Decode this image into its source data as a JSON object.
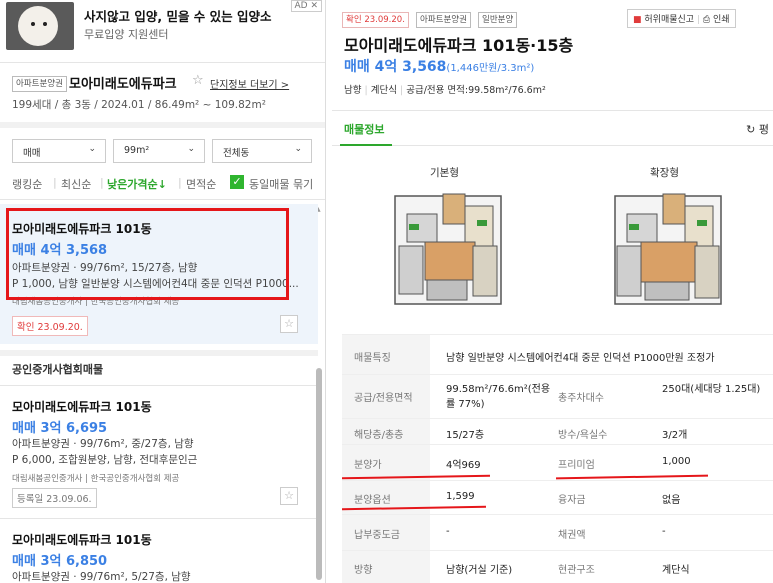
{
  "ad": {
    "badge": "AD ✕",
    "title": "사지않고 입양, 믿을 수 있는 입양소",
    "subtitle": "무료입양 지원센터"
  },
  "complex": {
    "tag": "아파트분양권",
    "name": "모아미래도에듀파크",
    "more_link": "단지정보 더보기 >",
    "meta": "199세대 / 총 3동 / 2024.01 / 86.49m² ~ 109.82m²"
  },
  "filters": {
    "type": "매매",
    "area": "99m²",
    "dong": "전체동"
  },
  "sort": {
    "items": [
      "랭킹순",
      "최신순",
      "낮은가격순↓",
      "면적순"
    ],
    "same_listing_label": "동일매물 묶기"
  },
  "listings": [
    {
      "title": "모아미래도에듀파크 101동",
      "price": "매매 4억 3,568",
      "spec": "아파트분양권 · 99/76m², 15/27층, 남향",
      "desc": "P 1,000, 남향 일반분양 시스템에어컨4대 중문 인덕션 P1000...",
      "agent": "대림새봄공인중개사 | 한국공인중개사협회 제공",
      "confirm": "확인 23.09.20."
    },
    {
      "title": "모아미래도에듀파크 101동",
      "price": "매매 3억 6,695",
      "spec": "아파트분양권 · 99/76m², 중/27층, 남향",
      "desc": "P 6,000, 조합원분양, 남향, 전대후문인근",
      "agent": "대림새봄공인중개사 | 한국공인중개사협회 제공",
      "confirm": "등록일 23.09.06."
    },
    {
      "title": "모아미래도에듀파크 101동",
      "price": "매매 3억 6,850",
      "spec": "아파트분양권 · 99/76m², 5/27층, 남향"
    }
  ],
  "section_title": "공인중개사협회매물",
  "detail": {
    "tags": [
      "확인 23.09.20.",
      "아파트분양권",
      "일반분양"
    ],
    "report": "허위매물신고",
    "print": "인쇄",
    "title": "모아미래도에듀파크 101동·15층",
    "price": "매매 4억 3,568",
    "price_per": "(1,446만원/3.3m²)",
    "meta": [
      "남향",
      "계단식",
      "공급/전용 면적:99.58m²/76.6m²"
    ],
    "tab": "매물정보",
    "refresh": "평",
    "plan_basic": "기본형",
    "plan_ext": "확장형",
    "rows": [
      {
        "k1": "매물특징",
        "v1": "남향 일반분양 시스템에어컨4대 중문 인덕션 P1000만원 조정가"
      },
      {
        "k1": "공급/전용면적",
        "v1": "99.58m²/76.6m²(전용률 77%)",
        "k2": "총주차대수",
        "v2": "250대(세대당 1.25대)"
      },
      {
        "k1": "해당층/총층",
        "v1": "15/27층",
        "k2": "방수/욕실수",
        "v2": "3/2개"
      },
      {
        "k1": "분양가",
        "v1": "4억969",
        "k2": "프리미엄",
        "v2": "1,000"
      },
      {
        "k1": "분양옵션",
        "v1": "1,599",
        "k2": "융자금",
        "v2": "없음"
      },
      {
        "k1": "납부중도금",
        "v1": "-",
        "k2": "채권액",
        "v2": "-"
      },
      {
        "k1": "방향",
        "v1": "남향(거실 기준)",
        "k2": "현관구조",
        "v2": "계단식"
      }
    ]
  }
}
